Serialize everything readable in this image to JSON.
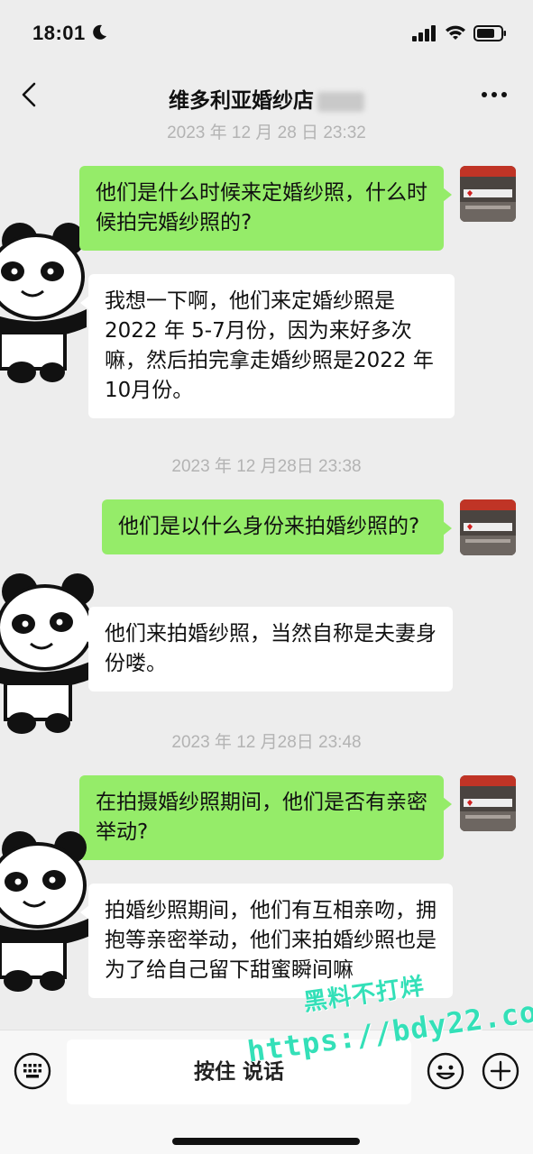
{
  "status_bar": {
    "time": "18:01",
    "icons": [
      "moon-icon",
      "signal-icon",
      "wifi-icon",
      "battery-icon"
    ]
  },
  "nav": {
    "title": "维多利亚婚纱店",
    "icons": [
      "back-icon",
      "more-icon"
    ]
  },
  "messages": [
    {
      "type": "timestamp",
      "text": "2023 年 12 月 28 日 23:32"
    },
    {
      "type": "out",
      "text": "他们是什么时候来定婚纱照，什么时候拍完婚纱照的?"
    },
    {
      "type": "in",
      "text": "我想一下啊，他们来定婚纱照是2022 年 5-7月份，因为来好多次嘛，然后拍完拿走婚纱照是2022 年 10月份。"
    },
    {
      "type": "timestamp",
      "text": "2023 年 12 月28日 23:38"
    },
    {
      "type": "out",
      "text": "他们是以什么身份来拍婚纱照的?"
    },
    {
      "type": "in",
      "text": "他们来拍婚纱照，当然自称是夫妻身份喽。"
    },
    {
      "type": "timestamp",
      "text": "2023 年 12 月28日 23:48"
    },
    {
      "type": "out",
      "text": "在拍摄婚纱照期间，他们是否有亲密举动?"
    },
    {
      "type": "in",
      "text": "拍婚纱照期间，他们有互相亲吻，拥抱等亲密举动，他们来拍婚纱照也是为了给自己留下甜蜜瞬间嘛"
    }
  ],
  "input_bar": {
    "hold_to_talk": "按住 说话",
    "icons": [
      "keyboard-icon",
      "emoji-icon",
      "plus-icon"
    ]
  },
  "watermark": {
    "line1": "黑料不打烊",
    "line2": "https://bdy22.co"
  },
  "colors": {
    "background": "#ededed",
    "outgoing_bubble": "#95ec69",
    "incoming_bubble": "#ffffff",
    "timestamp_text": "#b3b3b3",
    "watermark": "#34e0b8"
  }
}
